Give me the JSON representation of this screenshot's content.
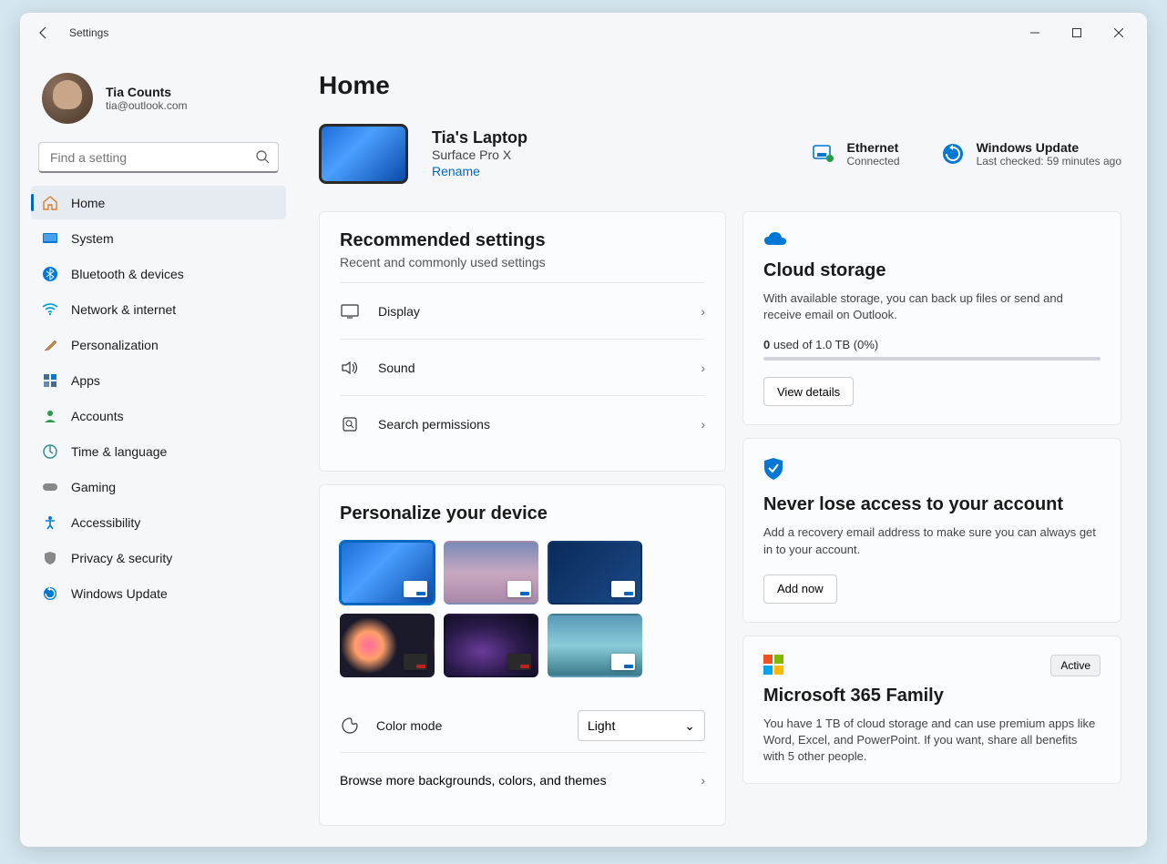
{
  "titlebar": {
    "title": "Settings"
  },
  "profile": {
    "name": "Tia Counts",
    "email": "tia@outlook.com"
  },
  "search": {
    "placeholder": "Find a setting"
  },
  "nav": {
    "items": [
      {
        "label": "Home"
      },
      {
        "label": "System"
      },
      {
        "label": "Bluetooth & devices"
      },
      {
        "label": "Network & internet"
      },
      {
        "label": "Personalization"
      },
      {
        "label": "Apps"
      },
      {
        "label": "Accounts"
      },
      {
        "label": "Time & language"
      },
      {
        "label": "Gaming"
      },
      {
        "label": "Accessibility"
      },
      {
        "label": "Privacy & security"
      },
      {
        "label": "Windows Update"
      }
    ]
  },
  "page": {
    "title": "Home"
  },
  "device": {
    "name": "Tia's Laptop",
    "model": "Surface Pro X",
    "rename": "Rename"
  },
  "status": {
    "network": {
      "title": "Ethernet",
      "sub": "Connected"
    },
    "update": {
      "title": "Windows Update",
      "sub": "Last checked: 59 minutes ago"
    }
  },
  "recommended": {
    "title": "Recommended settings",
    "sub": "Recent and commonly used settings",
    "items": [
      {
        "label": "Display"
      },
      {
        "label": "Sound"
      },
      {
        "label": "Search permissions"
      }
    ]
  },
  "personalize": {
    "title": "Personalize your device",
    "color_mode_label": "Color mode",
    "color_mode_value": "Light",
    "browse": "Browse more backgrounds, colors, and themes"
  },
  "cloud": {
    "title": "Cloud storage",
    "desc": "With available storage, you can back up files or send and receive email on Outlook.",
    "usage_prefix": "0",
    "usage_rest": " used of 1.0 TB (0%)",
    "button": "View details"
  },
  "recovery": {
    "title": "Never lose access to your account",
    "desc": "Add a recovery email address to make sure you can always get in to your account.",
    "button": "Add now"
  },
  "m365": {
    "title": "Microsoft 365 Family",
    "badge": "Active",
    "desc": "You have 1 TB of cloud storage and can use premium apps like Word, Excel, and PowerPoint. If you want, share all benefits with 5 other people."
  }
}
